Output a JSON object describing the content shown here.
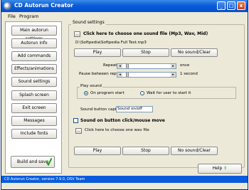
{
  "window": {
    "title": "CD Autorun Creator",
    "controls": {
      "minimize": "_",
      "maximize": "□",
      "close": "x"
    }
  },
  "menu": {
    "items": [
      "File",
      "Program"
    ]
  },
  "sidebar": {
    "items": [
      "Main autorun settings",
      "Autorun info",
      "Add commands",
      "Effects/animations",
      "Sound settings",
      "Splash screen",
      "Exit screen",
      "Messages",
      "Include fonts"
    ],
    "build_label": "Build and save"
  },
  "sound": {
    "group_title": "Sound settings",
    "choose_file": "Click here to choose one sound file (Mp3, Wav, Mid)",
    "file_path": "D:\\Softpedia\\Softpedia Full Test.mp3",
    "buttons": {
      "play": "Play",
      "stop": "Stop",
      "no_sound": "No sound/Clear"
    },
    "repeat_label": "Repeat",
    "repeat_value": "once",
    "pause_label": "Pause between repeat",
    "pause_value": "1 second",
    "play_sound_title": "Play sound",
    "on_program_start": "On program start",
    "wait_for_user": "Wait for user to start it",
    "caption_label": "Sound button caption",
    "caption_value": "Sound on/off",
    "mouse_move_label": "Sound on button click/mouse move",
    "choose_wav": "Click here to choose one wav file"
  },
  "help_label": "Help",
  "status": "CD Autorun Creator, version 7.9.0, DSV Team"
}
